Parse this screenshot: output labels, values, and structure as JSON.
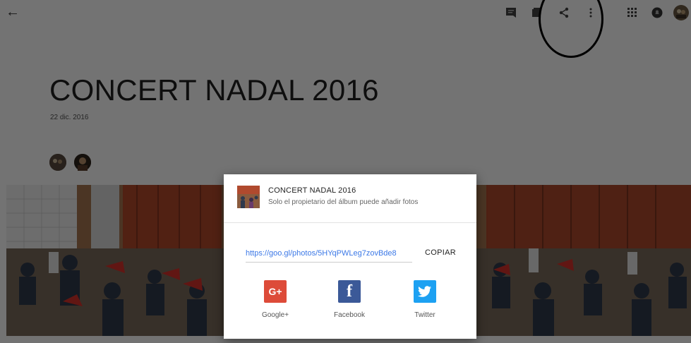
{
  "album": {
    "title": "CONCERT NADAL 2016",
    "date": "22 dic. 2016"
  },
  "topbar": {
    "icons": [
      "back-arrow-icon",
      "comment-icon",
      "add-to-album-icon",
      "share-icon",
      "more-vert-icon",
      "apps-grid-icon",
      "notifications-icon",
      "account-avatar"
    ]
  },
  "share_dialog": {
    "album_title": "CONCERT NADAL 2016",
    "subtitle": "Solo el propietario del álbum puede añadir fotos",
    "link": "https://goo.gl/photos/5HYqPWLeg7zovBde8",
    "copy_label": "COPIAR",
    "options": [
      {
        "label": "Google+",
        "icon": "google-plus-icon",
        "color": "#dd4b39",
        "glyph": "G+"
      },
      {
        "label": "Facebook",
        "icon": "facebook-icon",
        "color": "#3b5998",
        "glyph": "f"
      },
      {
        "label": "Twitter",
        "icon": "twitter-icon",
        "color": "#1da1f2",
        "glyph": ""
      }
    ]
  },
  "colors": {
    "scrim": "rgba(0,0,0,0.55)",
    "link": "#3b78e7",
    "annotation": "#000000"
  }
}
